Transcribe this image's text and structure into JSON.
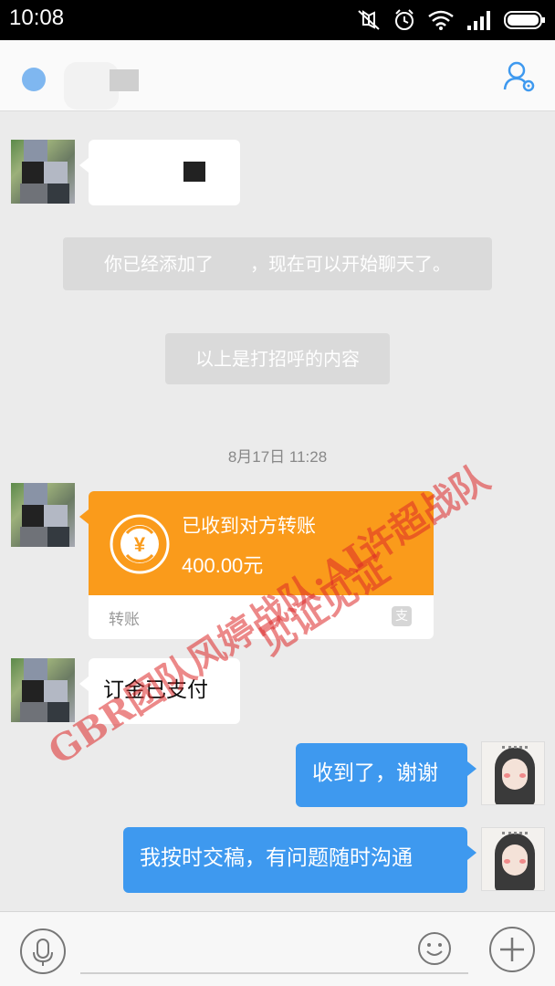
{
  "status_bar": {
    "time": "10:08",
    "icons": [
      "mute-icon",
      "alarm-icon",
      "wifi-icon",
      "signal-icon",
      "battery-icon"
    ]
  },
  "nav": {
    "back_icon": "back-icon",
    "profile_icon": "profile-settings-icon"
  },
  "messages": {
    "system_added": "你已经添加了　　，现在可以开始聊天了。",
    "system_greeting": "以上是打招呼的内容",
    "timestamp": "8月17日 11:28",
    "transfer": {
      "title": "已收到对方转账",
      "amount": "400.00元",
      "footer_label": "转账",
      "coin_symbol": "¥",
      "footer_icon_glyph": "支"
    },
    "incoming_deposit": "订金已支付",
    "outgoing_1": "收到了，谢谢",
    "outgoing_2": "我按时交稿，有问题随时沟通"
  },
  "watermark": {
    "line1": "GBR团队风婷战队·AI许超战队",
    "line2": "见证见证"
  },
  "colors": {
    "outgoing_bubble": "#3e99ef",
    "transfer_card": "#fa9b1b",
    "background": "#ebebeb",
    "watermark": "#dc2828"
  }
}
